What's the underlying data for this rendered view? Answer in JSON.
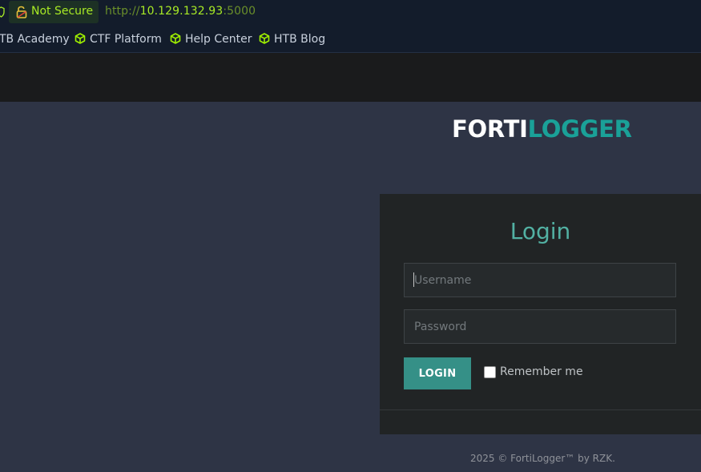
{
  "browser": {
    "security_label": "Not Secure",
    "url": {
      "scheme": "http://",
      "host": "10.129.132.93",
      "port": ":5000"
    },
    "bookmarks": [
      {
        "label": "TB Academy",
        "icon": "none"
      },
      {
        "label": "CTF Platform",
        "icon": "cube-icon"
      },
      {
        "label": "Help Center",
        "icon": "cube-icon"
      },
      {
        "label": "HTB Blog",
        "icon": "cube-icon"
      }
    ],
    "accent_color": "#a8ea25"
  },
  "brand": {
    "part1": "FORTI",
    "part2": "LOGGER",
    "color_primary": "#ffffff",
    "color_accent": "#1aa198"
  },
  "login": {
    "title": "Login",
    "username_placeholder": "Username",
    "password_placeholder": "Password",
    "button_label": "LOGIN",
    "remember_label": "Remember me"
  },
  "footer": {
    "text": "2025 © FortiLogger™ by RZK."
  }
}
